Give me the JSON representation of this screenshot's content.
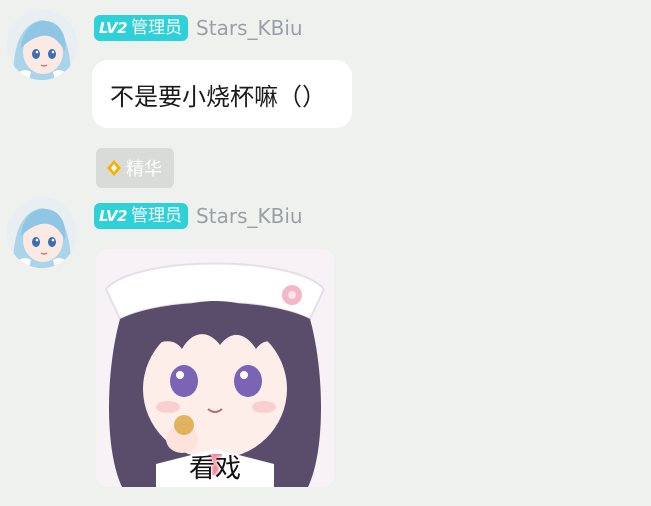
{
  "messages": [
    {
      "user": {
        "level_badge": "LV2",
        "role": "管理员",
        "username": "Stars_KBiu",
        "avatar_icon": "anime-girl-avatar"
      },
      "text": "不是要小烧杯嘛（）",
      "tag": {
        "icon": "diamond-icon",
        "label": "精华"
      }
    },
    {
      "user": {
        "level_badge": "LV2",
        "role": "管理员",
        "username": "Stars_KBiu",
        "avatar_icon": "anime-girl-avatar"
      },
      "sticker": {
        "caption": "看戏"
      }
    }
  ],
  "colors": {
    "background": "#eef1ee",
    "badge": "#2fd1d8",
    "username": "#9aa0a6",
    "tag_background": "#d8dbd8",
    "tag_icon": "#f5b400"
  }
}
